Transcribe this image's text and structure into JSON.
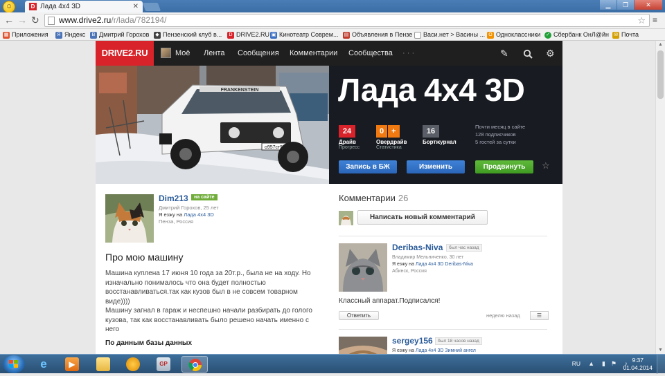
{
  "browser": {
    "tab_title": "Лада 4x4 3D",
    "tab_favicon": "D",
    "url_domain": "www.drive2.ru",
    "url_path": "/r/lada/782194/",
    "bookmarks": [
      {
        "label": "Приложения",
        "icon": "apps-grid-icon",
        "color": "#e0522e"
      },
      {
        "label": "Яндекс",
        "icon": "yandex-icon",
        "color": "#4a73b8"
      },
      {
        "label": "Дмитрий Горохов",
        "icon": "vk-icon",
        "color": "#4a73b8"
      },
      {
        "label": "Пензенский клуб в...",
        "icon": "club-icon",
        "color": "#444"
      },
      {
        "label": "DRIVE2.RU",
        "icon": "drive2-icon",
        "color": "#d8232a"
      },
      {
        "label": "Кинотеатр Соврем...",
        "icon": "cinema-icon",
        "color": "#3b6fc4"
      },
      {
        "label": "Объявления в Пензе",
        "icon": "ads-icon",
        "color": "#c0392b"
      },
      {
        "label": "Васи.нет > Васины ...",
        "icon": "page-icon",
        "color": "#888"
      },
      {
        "label": "Одноклассники",
        "icon": "ok-icon",
        "color": "#f39200"
      },
      {
        "label": "Сбербанк ОнЛ@йн",
        "icon": "sberbank-icon",
        "color": "#21a038"
      },
      {
        "label": "Почта",
        "icon": "mail-icon",
        "color": "#d4a000"
      }
    ]
  },
  "site": {
    "logo": "DRIVE2.RU",
    "nav": [
      "Моё",
      "Лента",
      "Сообщения",
      "Комментарии",
      "Сообщества",
      "· · ·"
    ],
    "car_title": "Лада 4x4 3D",
    "plate": "о957ст58",
    "windshield_text": "FRANKENSTEIN",
    "stats": [
      {
        "value": "24",
        "label": "Драйв",
        "sub": "Прогресс",
        "color": "#d8232a"
      },
      {
        "value": "0",
        "plus": "+",
        "label": "Овердрайв",
        "sub": "Статистика",
        "color": "#f07a11"
      },
      {
        "value": "16",
        "label": "Бортжурнал",
        "sub": "",
        "color": "#5a5e66"
      }
    ],
    "meta": [
      "Почти месяц в сайте",
      "128 подписчиков",
      "5 гостей за сутки"
    ],
    "buttons": {
      "logbook": "Запись в БЖ",
      "edit": "Изменить",
      "promote": "Продвинуть"
    },
    "owner": {
      "name": "Dim213",
      "status": "на сайте",
      "fullname": "Дмитрий Горохов, 25 лет",
      "drives_prefix": "Я езжу на",
      "drives_car": "Лада 4x4 3D",
      "city": "Пенза, Россия"
    },
    "about_title": "Про мою машину",
    "about_text": "Машина куплена 17 июня 10 года за 20т.р., была не на ходу. Но изначально понималось что она будет полностью восстанавливаться.так как кузов был в не совсем товарном виде))))\nМашину загнал в гараж и неспешно начали разбирать до голого кузова, так как восстанавливать было решено начать именно с него",
    "db_title": "По данным базы данных",
    "comments": {
      "title": "Комментарии",
      "count": "26",
      "write_button": "Написать новый комментарий",
      "items": [
        {
          "name": "Deribas-Niva",
          "time": "был час назад",
          "info1": "Владимир Мельниченко, 30 лет",
          "drives_prefix": "Я езжу на",
          "drives_car": "Лада 4x4 3D Deribas-Niva",
          "city": "Абинск, Россия",
          "text": "Классный аппарат.Подписался!",
          "reply": "Ответить",
          "ago": "неделю назад",
          "menu": "☰"
        },
        {
          "name": "sergey156",
          "time": "был 18 часов назад",
          "drives_prefix": "Я езжу на",
          "drives_car": "Лада 4x4 3D Зимний ангел"
        }
      ]
    }
  },
  "taskbar": {
    "lang": "RU",
    "time": "9:37",
    "date": "01.04.2014",
    "apps": [
      "ie-icon",
      "media-player-icon",
      "explorer-folder-icon",
      "winamp-icon",
      "gp-icon",
      "chrome-icon"
    ],
    "app_labels": {
      "gp": "GP"
    }
  }
}
